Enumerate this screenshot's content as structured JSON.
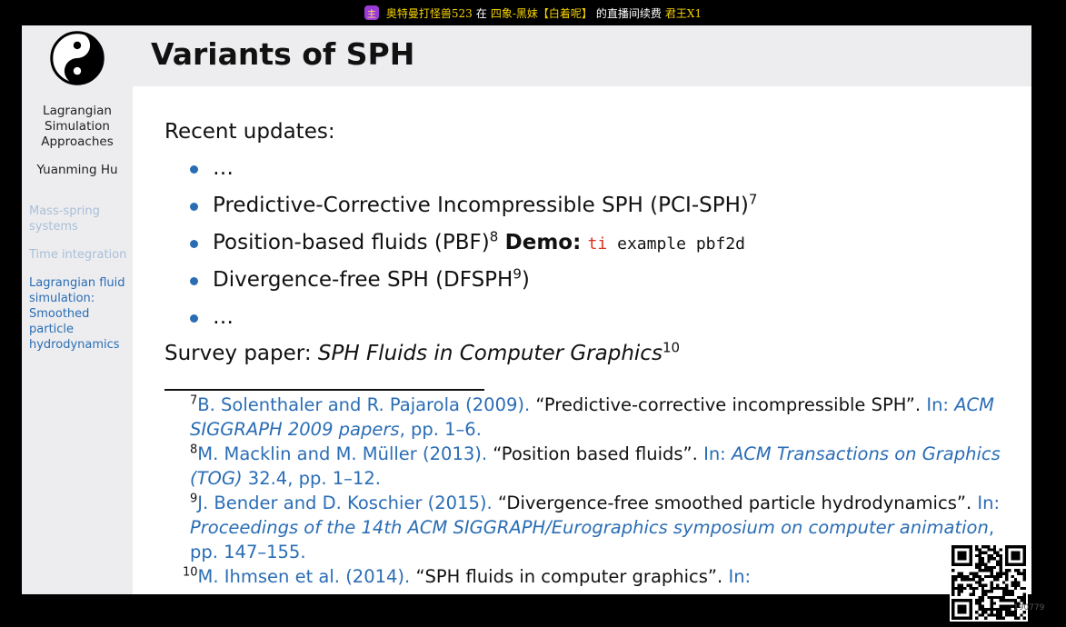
{
  "stream_banner": {
    "badge": "主",
    "user": "奥特曼打怪兽523",
    "text_in": "在",
    "room": "四象-黑妹【白着呢】",
    "text_action": "的直播间续费",
    "gift": "君王X1"
  },
  "slide": {
    "title": "Variants of SPH",
    "sidebar": {
      "logo": "yin-yang-icon",
      "talk_title_lines": [
        "Lagrangian",
        "Simulation",
        "Approaches"
      ],
      "author": "Yuanming Hu",
      "nav": [
        {
          "label_lines": [
            "Mass-spring",
            "systems"
          ],
          "active": false
        },
        {
          "label_lines": [
            "Time integration"
          ],
          "active": false
        },
        {
          "label_lines": [
            "Lagrangian fluid",
            "simulation:",
            "Smoothed",
            "particle",
            "hydrodynamics"
          ],
          "active": true
        }
      ]
    },
    "recent_updates_label": "Recent updates:",
    "bullets": {
      "b1": "…",
      "b2_text": "Predictive-Corrective Incompressible SPH (PCI-SPH)",
      "b2_ref": "7",
      "b3_text": "Position-based fluids (PBF)",
      "b3_ref": "8",
      "b3_demo": "Demo:",
      "b3_code_kw": "ti",
      "b3_code_rest": "example pbf2d",
      "b4_text": "Divergence-free SPH (DFSPH",
      "b4_ref": "9",
      "b4_close": ")",
      "b5": "…"
    },
    "survey": {
      "label": "Survey paper:",
      "title": "SPH Fluids in Computer Graphics",
      "ref": "10"
    },
    "footnotes": {
      "f7": {
        "num": "7",
        "authors": "B. Solenthaler and R. Pajarola (2009).",
        "title": "“Predictive-corrective incompressible SPH”.",
        "in": "In:",
        "venue": "ACM SIGGRAPH 2009 papers",
        "pages": ", pp. 1–6."
      },
      "f8": {
        "num": "8",
        "authors": "M. Macklin and M. Müller (2013).",
        "title": "“Position based fluids”.",
        "in": "In:",
        "venue": "ACM Transactions on Graphics (TOG)",
        "pages": " 32.4, pp. 1–12."
      },
      "f9": {
        "num": "9",
        "authors": "J. Bender and D. Koschier (2015).",
        "title": "“Divergence-free smoothed particle hydrodynamics”.",
        "in": "In:",
        "venue": "Proceedings of the 14th ACM SIGGRAPH/Eurographics symposium on computer animation",
        "pages": ", pp. 147–155."
      },
      "f10": {
        "num": "10",
        "authors": "M. Ihmsen et al. (2014).",
        "title": "“SPH fluids in computer graphics”.",
        "in": "In:"
      }
    }
  },
  "overlay": {
    "qr": "qr-code-icon",
    "watermark": "190779"
  },
  "colors": {
    "accent": "#2a6db5",
    "code_keyword": "#e0301e",
    "nav_inactive": "#a9bfd7",
    "sidebar_bg": "#ededef"
  }
}
